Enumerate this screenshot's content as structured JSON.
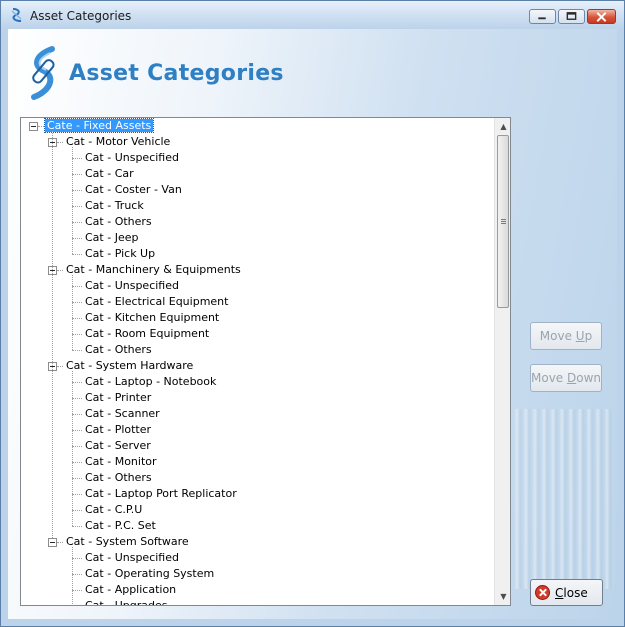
{
  "window": {
    "title": "Asset Categories",
    "header_title": "Asset Categories"
  },
  "tree": {
    "root": "Cate - Fixed Assets",
    "groups": [
      {
        "label": "Cat - Motor Vehicle",
        "children": [
          "Cat - Unspecified",
          "Cat - Car",
          "Cat - Coster - Van",
          "Cat - Truck",
          "Cat - Others",
          "Cat - Jeep",
          "Cat - Pick Up"
        ]
      },
      {
        "label": "Cat - Manchinery & Equipments",
        "children": [
          "Cat - Unspecified",
          "Cat - Electrical Equipment",
          "Cat - Kitchen Equipment",
          "Cat - Room Equipment",
          "Cat - Others"
        ]
      },
      {
        "label": "Cat - System Hardware",
        "children": [
          "Cat - Laptop -  Notebook",
          "Cat - Printer",
          "Cat - Scanner",
          "Cat - Plotter",
          "Cat - Server",
          "Cat - Monitor",
          "Cat - Others",
          "Cat - Laptop Port Replicator",
          "Cat - C.P.U",
          "Cat - P.C. Set"
        ]
      },
      {
        "label": "Cat - System Software",
        "children": [
          "Cat - Unspecified",
          "Cat - Operating System",
          "Cat - Application",
          "Cat - Upgrades"
        ]
      }
    ]
  },
  "buttons": {
    "move_up": {
      "pre": "Move ",
      "key": "U",
      "post": "p"
    },
    "move_down": {
      "pre": "Move ",
      "key": "D",
      "post": "own"
    },
    "close": {
      "pre": "",
      "key": "C",
      "post": "lose"
    }
  },
  "icons": {
    "app": "asset-logo-icon",
    "minimize": "minimize-icon",
    "maximize": "maximize-icon",
    "close": "close-icon"
  }
}
